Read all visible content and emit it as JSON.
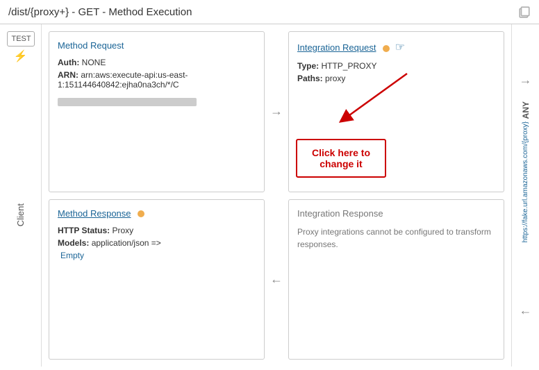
{
  "title": "/dist/{proxy+} - GET - Method Execution",
  "sidebar": {
    "test_label": "TEST",
    "client_label": "Client"
  },
  "right_sidebar": {
    "any_label": "ANY",
    "url_label": "https://fake.url.amazonaws.com/{proxy}"
  },
  "method_request": {
    "title": "Method Request",
    "auth_label": "Auth:",
    "auth_value": "NONE",
    "arn_label": "ARN:",
    "arn_value": "arn:aws:execute-api:us-east-1:151144640842:ejha0na3ch/*/C"
  },
  "integration_request": {
    "title": "Integration Request",
    "has_dot": true,
    "type_label": "Type:",
    "type_value": "HTTP_PROXY",
    "paths_label": "Paths:",
    "paths_value": "proxy",
    "callout_text": "Click here to change it"
  },
  "method_response": {
    "title": "Method Response",
    "has_dot": true,
    "http_status_label": "HTTP Status:",
    "http_status_value": "Proxy",
    "models_label": "Models:",
    "models_value": "application/json =>",
    "models_subvalue": "Empty"
  },
  "integration_response": {
    "title": "Integration Response",
    "message": "Proxy integrations cannot be configured to transform responses."
  },
  "arrows": {
    "right": "→",
    "left": "←"
  }
}
